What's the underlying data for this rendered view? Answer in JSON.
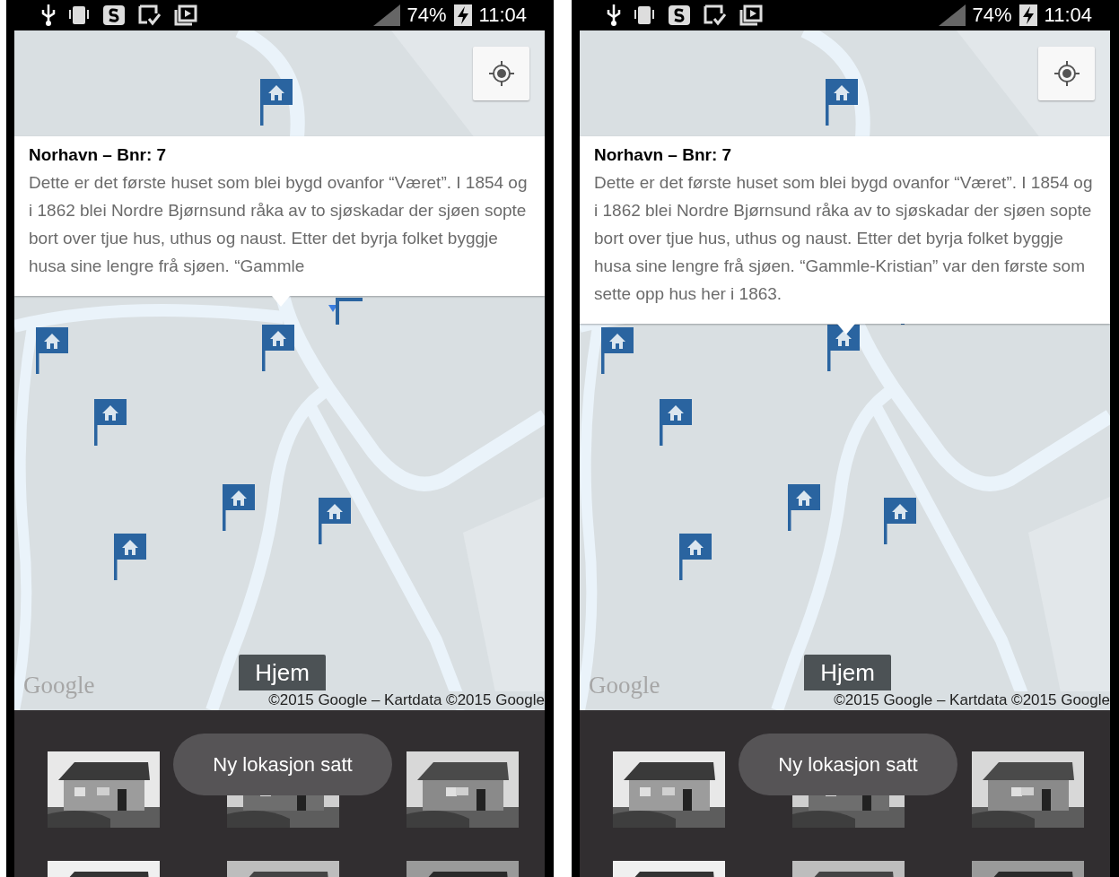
{
  "screens": [
    {
      "status_bar": {
        "battery": "74%",
        "time": "11:04"
      },
      "info_window": {
        "title": "Norhavn – Bnr: 7",
        "text": "Dette er det første huset som blei bygd ovanfor “Været”. I 1854 og i 1862 blei Nordre Bjørnsund råka av to sjøskadar der sjøen sopte bort over tjue hus, uthus og naust. Etter det byrja folket byggje husa sine lengre frå sjøen. “Gammle"
      },
      "home_button": "Hjem",
      "attribution": {
        "logo": "Google",
        "copyright": "©2015 Google – Kartdata ©2015 Google"
      },
      "toast": "Ny lokasjon satt"
    },
    {
      "status_bar": {
        "battery": "74%",
        "time": "11:04"
      },
      "info_window": {
        "title": "Norhavn – Bnr: 7",
        "text": "Dette er det første huset som blei bygd ovanfor “Været”. I 1854 og i 1862 blei Nordre Bjørnsund råka av to sjøskadar der sjøen sopte bort over tjue hus, uthus og naust. Etter det byrja folket byggje husa sine lengre frå sjøen. “Gammle-Kristian” var den første som sette opp hus her i 1863."
      },
      "home_button": "Hjem",
      "attribution": {
        "logo": "Google",
        "copyright": "©2015 Google – Kartdata ©2015 Google"
      },
      "toast": "Ny lokasjon satt"
    }
  ]
}
